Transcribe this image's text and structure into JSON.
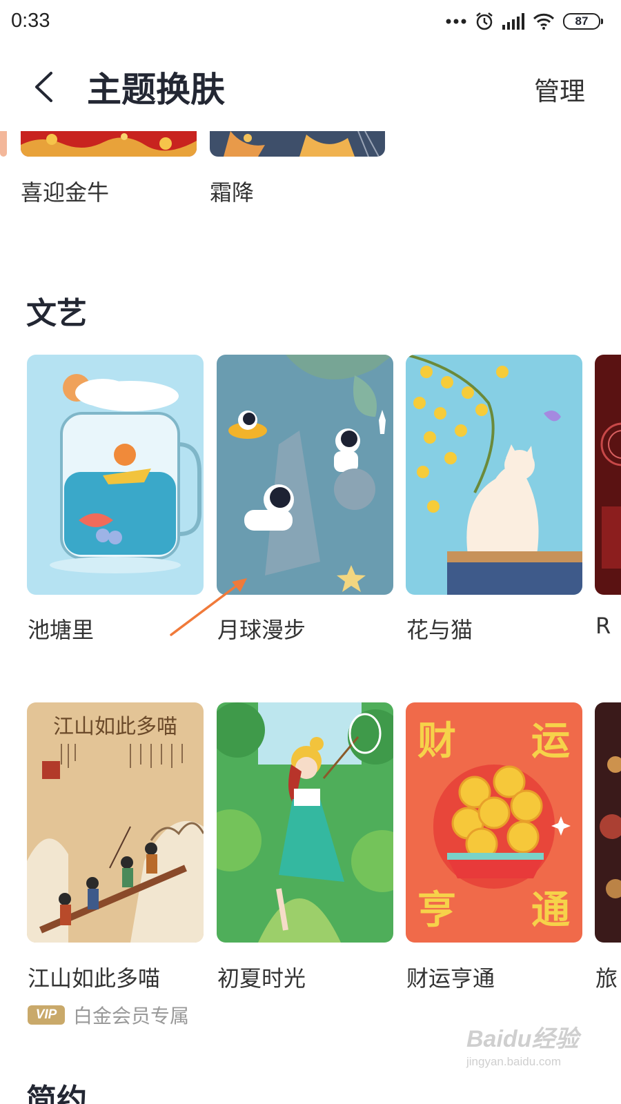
{
  "status_bar": {
    "time": "0:33",
    "battery": "87",
    "icons": [
      "more-dots-icon",
      "alarm-icon",
      "cellular-signal-icon",
      "wifi-icon",
      "battery-icon"
    ]
  },
  "header": {
    "title": "主题换肤",
    "manage_label": "管理",
    "back_icon": "chevron-left-icon"
  },
  "previous_row": {
    "items": [
      {
        "label": "喜迎金牛"
      },
      {
        "label": "霜降"
      }
    ]
  },
  "sections": [
    {
      "title": "文艺",
      "rows": [
        [
          {
            "label": "池塘里"
          },
          {
            "label": "月球漫步"
          },
          {
            "label": "花与猫"
          },
          {
            "label": "R"
          }
        ],
        [
          {
            "label": "江山如此多喵",
            "vip_badge": "VIP",
            "vip_text": "白金会员专属"
          },
          {
            "label": "初夏时光"
          },
          {
            "label": "财运亨通"
          },
          {
            "label": "旅"
          }
        ]
      ]
    },
    {
      "title": "简约"
    }
  ],
  "thumbnail_text": {
    "jiangshan_title": "江山如此多喵",
    "caiyun_chars": [
      "财",
      "运",
      "亨",
      "通"
    ]
  },
  "watermark": {
    "logo": "Baidu经验",
    "url": "jingyan.baidu.com"
  },
  "colors": {
    "annotation_arrow": "#f07a3a",
    "vip_gold": "#c9a96a"
  }
}
